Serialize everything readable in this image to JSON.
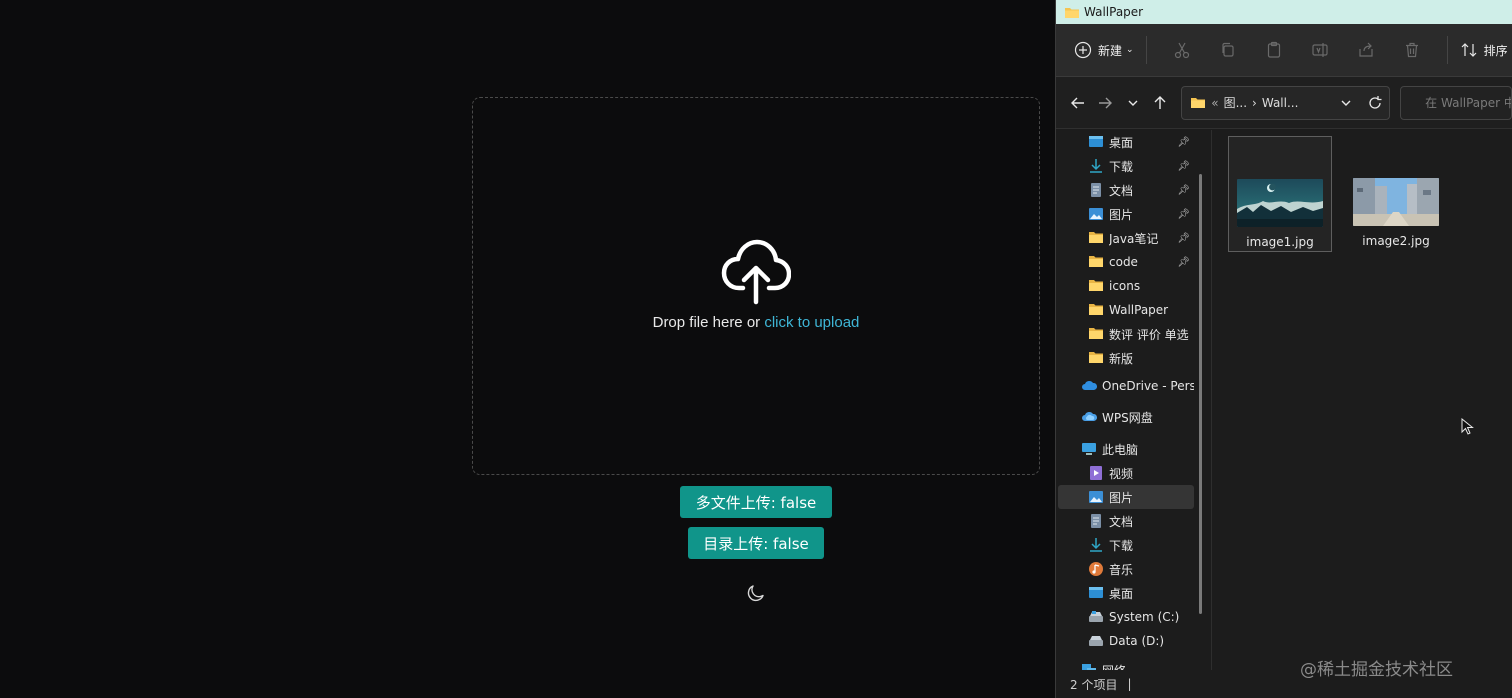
{
  "upload": {
    "drop_text": "Drop file here or ",
    "click_text": "click to upload"
  },
  "buttons": {
    "multi_file": "多文件上传: false",
    "directory": "目录上传: false"
  },
  "theme": {
    "icon": "moon-icon"
  },
  "explorer": {
    "title": "WallPaper",
    "toolbar": {
      "new_label": "新建",
      "sort_label": "排序"
    },
    "address": {
      "prefix": "«",
      "seg1": "图...",
      "seg2": "Wall..."
    },
    "search_placeholder": "在 WallPaper 中搜索",
    "sidebar": {
      "quick": [
        {
          "label": "桌面",
          "icon": "desktop-icon",
          "pinned": true
        },
        {
          "label": "下载",
          "icon": "download-icon",
          "pinned": true
        },
        {
          "label": "文档",
          "icon": "document-icon",
          "pinned": true
        },
        {
          "label": "图片",
          "icon": "pictures-icon",
          "pinned": true
        },
        {
          "label": "Java笔记",
          "icon": "folder-icon",
          "pinned": true
        },
        {
          "label": "code",
          "icon": "folder-icon",
          "pinned": true
        },
        {
          "label": "icons",
          "icon": "folder-icon",
          "pinned": false
        },
        {
          "label": "WallPaper",
          "icon": "folder-icon",
          "pinned": false
        },
        {
          "label": "数评 评价 单选",
          "icon": "folder-icon",
          "pinned": false
        },
        {
          "label": "新版",
          "icon": "folder-icon",
          "pinned": false
        }
      ],
      "onedrive": "OneDrive - Personal",
      "wps": "WPS网盘",
      "this_pc": "此电脑",
      "pc_items": [
        {
          "label": "视频",
          "icon": "video-icon"
        },
        {
          "label": "图片",
          "icon": "pictures-icon"
        },
        {
          "label": "文档",
          "icon": "document-icon"
        },
        {
          "label": "下载",
          "icon": "download-icon"
        },
        {
          "label": "音乐",
          "icon": "music-icon"
        },
        {
          "label": "桌面",
          "icon": "desktop-icon"
        },
        {
          "label": "System (C:)",
          "icon": "drive-icon"
        },
        {
          "label": "Data (D:)",
          "icon": "drive-icon"
        }
      ],
      "network": "网络"
    },
    "files": [
      {
        "name": "image1.jpg"
      },
      {
        "name": "image2.jpg"
      }
    ],
    "status": "2 个项目",
    "status_sep": "|"
  },
  "watermark": "@稀土掘金技术社区",
  "colors": {
    "accent_teal": "#10958a",
    "link": "#3fb6d6",
    "titlebar": "#cfeee8"
  }
}
